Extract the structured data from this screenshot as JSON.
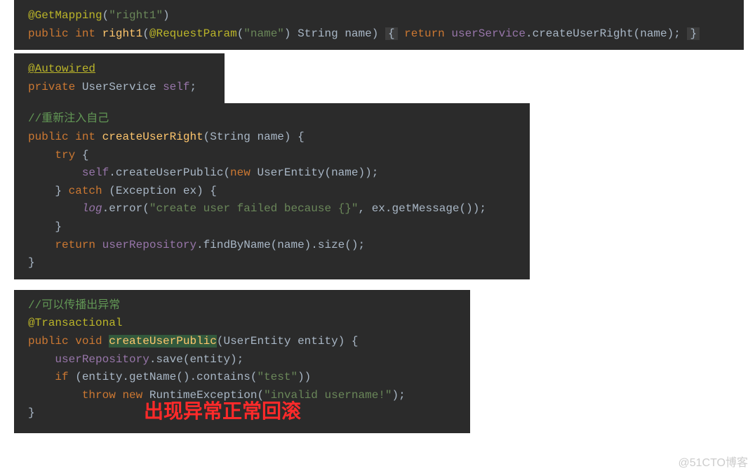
{
  "block1": {
    "ann_get": "@GetMapping",
    "paren_open": "(",
    "path_str": "\"right1\"",
    "paren_close": ")",
    "kw_public": "public",
    "kw_int": "int",
    "method": "right1",
    "ann_param": "@RequestParam",
    "param_str": "\"name\"",
    "type_string": "String",
    "param_name": "name",
    "kw_return": "return",
    "field_userService": "userService",
    "call": ".createUserRight(name);"
  },
  "block2": {
    "ann_autowired": "@Autowired",
    "kw_private": "private",
    "type_userservice": "UserService",
    "field_self": "self",
    "semi": ";"
  },
  "block3": {
    "comment1": "//重新注入自己",
    "kw_public": "public",
    "kw_int": "int",
    "method": "createUserRight",
    "sig_rest": "(String name) {",
    "kw_try": "try",
    "brace_open": "{",
    "field_self": "self",
    "call_create": ".createUserPublic(",
    "kw_new": "new",
    "ctor": " UserEntity(name));",
    "brace_close": "}",
    "kw_catch": "catch",
    "catch_sig": "(Exception ex) {",
    "field_log": "log",
    "log_error_open": ".error(",
    "log_str": "\"create user failed because {}\"",
    "log_rest": ", ex.getMessage());",
    "brace_close3": "}",
    "kw_return": "return",
    "field_repo": "userRepository",
    "repo_rest": ".findByName(name).size();",
    "final_brace": "}"
  },
  "block4": {
    "comment": "//可以传播出异常",
    "ann_tx": "@Transactional",
    "kw_public": "public",
    "kw_void": "void",
    "method": "createUserPublic",
    "sig_rest": "(UserEntity entity) {",
    "field_repo": "userRepository",
    "save_rest": ".save(entity);",
    "kw_if": "if",
    "if_open": " (entity.getName().contains(",
    "test_str": "\"test\"",
    "if_close": "))",
    "kw_throw": "throw",
    "kw_new": "new",
    "ctor": " RuntimeException(",
    "ex_str": "\"invalid username!\"",
    "ex_close": ");",
    "final_brace": "}"
  },
  "overlay_text": "出现异常正常回滚",
  "watermark": "@51CTO博客"
}
